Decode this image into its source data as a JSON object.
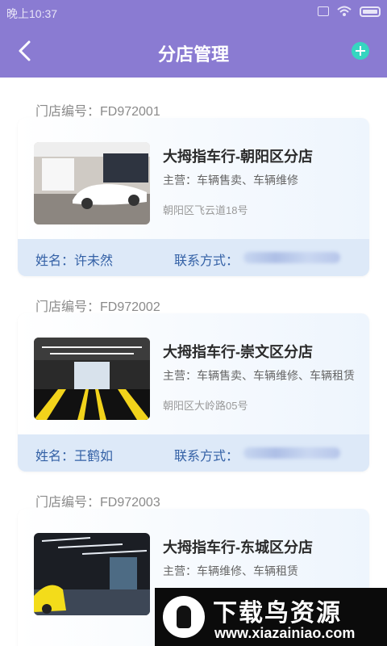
{
  "status_bar": {
    "time": "晚上10:37"
  },
  "header": {
    "title": "分店管理"
  },
  "stores": [
    {
      "id_label": "门店编号：FD972001",
      "name": "大拇指车行-朝阳区分店",
      "business": "主营：车辆售卖、车辆维修",
      "address": "朝阳区飞云道18号",
      "contact_name": "姓名：许未然",
      "contact_label": "联系方式："
    },
    {
      "id_label": "门店编号：FD972002",
      "name": "大拇指车行-崇文区分店",
      "business": "主营：车辆售卖、车辆维修、车辆租赁",
      "address": "朝阳区大岭路05号",
      "contact_name": "姓名：王鹤如",
      "contact_label": "联系方式："
    },
    {
      "id_label": "门店编号：FD972003",
      "name": "大拇指车行-东城区分店",
      "business": "主营：车辆维修、车辆租赁",
      "address": "",
      "contact_name": "",
      "contact_label": ""
    }
  ],
  "watermark": {
    "title": "下载鸟资源",
    "url": "www.xiazainiao.com"
  },
  "colors": {
    "header": "#8a7bd2",
    "accent": "#36d6c0",
    "contact": "#3461a6"
  },
  "icons": {
    "back": "chevron-left-icon",
    "add": "plus-circle-icon",
    "wifi": "wifi-icon",
    "battery": "battery-icon"
  }
}
